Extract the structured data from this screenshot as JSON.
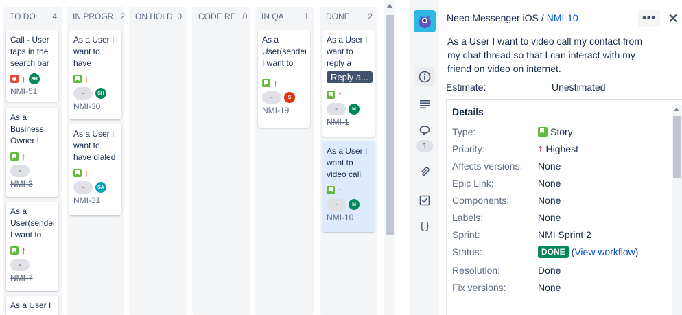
{
  "board": {
    "columns": [
      {
        "name": "TO DO",
        "count": "4",
        "cards": [
          {
            "summary": "Call - User taps in the search bar",
            "type": "bug",
            "priority": "highest",
            "assignee": "SH",
            "assignee_color": "#00875a",
            "key": "NMI-51",
            "done": false,
            "pill": ""
          },
          {
            "summary": "As a Business Owner I",
            "type": "story",
            "priority": "medium",
            "assignee": "",
            "assignee_color": "",
            "key": "NMI-3",
            "done": true,
            "pill": "-"
          },
          {
            "summary": "As a User(sender) I want to",
            "type": "story",
            "priority": "highest",
            "assignee": "",
            "assignee_color": "",
            "key": "NMI-7",
            "done": true,
            "pill": "-"
          },
          {
            "summary": "As a User I"
          }
        ]
      },
      {
        "name": "IN PROGR...",
        "count": "2",
        "cards": [
          {
            "summary": "As a User I want to have missed",
            "type": "story",
            "priority": "medium",
            "assignee": "SH",
            "assignee_color": "#00875a",
            "key": "NMI-30",
            "done": false,
            "pill": "-"
          },
          {
            "summary": "As a User I want to have dialed",
            "type": "story",
            "priority": "medium",
            "assignee": "SA",
            "assignee_color": "#00a3bf",
            "key": "NMI-31",
            "done": false,
            "pill": "-"
          }
        ]
      },
      {
        "name": "ON HOLD",
        "count": "0"
      },
      {
        "name": "CODE RE...",
        "count": "0"
      },
      {
        "name": "IN QA",
        "count": "1",
        "cards": [
          {
            "summary": "As a User(sender) I want to",
            "type": "story",
            "priority": "highest",
            "assignee": "S",
            "assignee_color": "#de350b",
            "key": "NMI-19",
            "done": false,
            "pill": "-"
          }
        ]
      },
      {
        "name": "DONE",
        "count": "2",
        "cards": [
          {
            "summary": "As a User I want to reply a",
            "epic": "Reply a...",
            "type": "story",
            "priority": "highest",
            "assignee": "M",
            "assignee_color": "#00875a",
            "key": "NMI-1",
            "done": true,
            "pill": "-"
          },
          {
            "summary": "As a User I want to video call",
            "type": "story",
            "priority": "highest",
            "assignee": "M",
            "assignee_color": "#00875a",
            "key": "NMI-10",
            "done": true,
            "pill": "-"
          }
        ]
      }
    ]
  },
  "detail": {
    "project": "Neeo Messenger iOS",
    "separator": "/",
    "issue_key": "NMI-10",
    "more": "•••",
    "close": "✕",
    "summary": "As a User I want to video call my contact from my chat thread so that I can interact with my friend on video on internet.",
    "estimate_label": "Estimate:",
    "estimate_value": "Unestimated",
    "comment_count": "1",
    "details_title": "Details",
    "fields": {
      "type_label": "Type:",
      "type_value": "Story",
      "priority_label": "Priority:",
      "priority_value": "Highest",
      "affects_label": "Affects versions:",
      "affects_value": "None",
      "epic_label": "Epic Link:",
      "epic_value": "None",
      "components_label": "Components:",
      "components_value": "None",
      "labels_label": "Labels:",
      "labels_value": "None",
      "sprint_label": "Sprint:",
      "sprint_value": "NMI Sprint 2",
      "status_label": "Status:",
      "status_value": "DONE",
      "workflow_link": "View workflow",
      "resolution_label": "Resolution:",
      "resolution_value": "Done",
      "fix_label": "Fix versions:",
      "fix_value": "None"
    }
  }
}
